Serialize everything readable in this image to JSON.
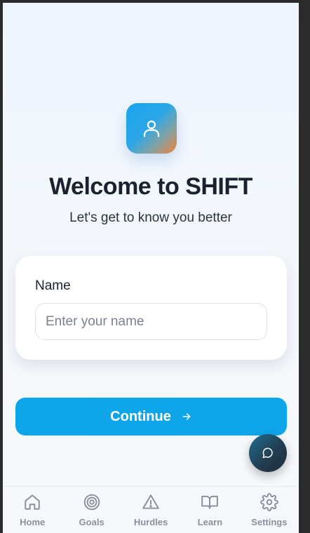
{
  "header": {
    "title": "Welcome to SHIFT",
    "subtitle": "Let's get to know you better",
    "avatar_icon": "user-icon"
  },
  "form": {
    "name_label": "Name",
    "name_placeholder": "Enter your name",
    "name_value": ""
  },
  "actions": {
    "continue_label": "Continue",
    "continue_icon": "arrow-right-icon"
  },
  "chat": {
    "icon": "chat-bubble-icon"
  },
  "bottom_nav": {
    "items": [
      {
        "label": "Home",
        "icon": "home-icon"
      },
      {
        "label": "Goals",
        "icon": "target-icon"
      },
      {
        "label": "Hurdles",
        "icon": "warning-icon"
      },
      {
        "label": "Learn",
        "icon": "book-icon"
      },
      {
        "label": "Settings",
        "icon": "gear-icon"
      }
    ]
  },
  "colors": {
    "accent": "#0ea5e9",
    "title": "#1a2230",
    "nav_inactive": "#8a919c",
    "avatar_gradient_start": "#1aa3ec",
    "avatar_gradient_end": "#f0813a"
  }
}
